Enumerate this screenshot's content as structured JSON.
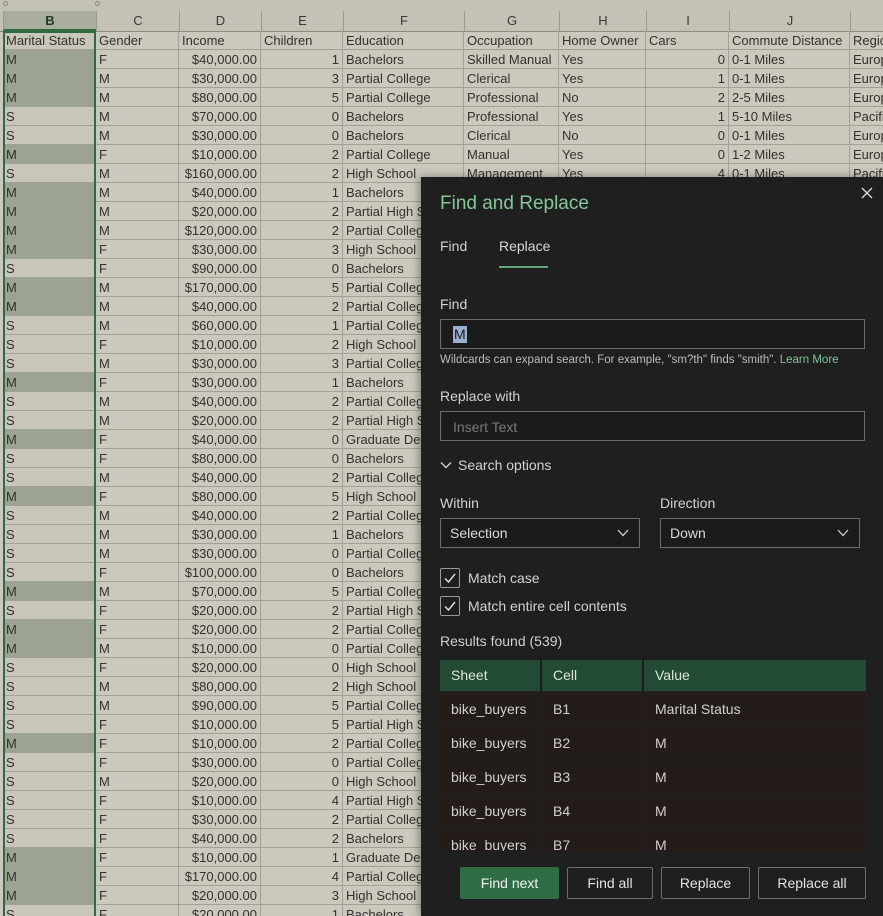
{
  "columns": [
    {
      "letter": "B",
      "header": "Marital Status"
    },
    {
      "letter": "C",
      "header": "Gender"
    },
    {
      "letter": "D",
      "header": "Income"
    },
    {
      "letter": "E",
      "header": "Children"
    },
    {
      "letter": "F",
      "header": "Education"
    },
    {
      "letter": "G",
      "header": "Occupation"
    },
    {
      "letter": "H",
      "header": "Home Owner"
    },
    {
      "letter": "I",
      "header": "Cars"
    },
    {
      "letter": "J",
      "header": "Commute Distance"
    },
    {
      "letter": "",
      "header": "Regic"
    }
  ],
  "rows": [
    [
      "M",
      "F",
      "$40,000.00",
      "1",
      "Bachelors",
      "Skilled Manual",
      "Yes",
      "0",
      "0-1 Miles",
      "Europ"
    ],
    [
      "M",
      "M",
      "$30,000.00",
      "3",
      "Partial College",
      "Clerical",
      "Yes",
      "1",
      "0-1 Miles",
      "Europ"
    ],
    [
      "M",
      "M",
      "$80,000.00",
      "5",
      "Partial College",
      "Professional",
      "No",
      "2",
      "2-5 Miles",
      "Europ"
    ],
    [
      "S",
      "M",
      "$70,000.00",
      "0",
      "Bachelors",
      "Professional",
      "Yes",
      "1",
      "5-10 Miles",
      "Pacifi"
    ],
    [
      "S",
      "M",
      "$30,000.00",
      "0",
      "Bachelors",
      "Clerical",
      "No",
      "0",
      "0-1 Miles",
      "Europ"
    ],
    [
      "M",
      "F",
      "$10,000.00",
      "2",
      "Partial College",
      "Manual",
      "Yes",
      "0",
      "1-2 Miles",
      "Europ"
    ],
    [
      "S",
      "M",
      "$160,000.00",
      "2",
      "High School",
      "Management",
      "Yes",
      "4",
      "0-1 Miles",
      "Pacifi"
    ],
    [
      "M",
      "M",
      "$40,000.00",
      "1",
      "Bachelors",
      "",
      "",
      "",
      "",
      ""
    ],
    [
      "M",
      "M",
      "$20,000.00",
      "2",
      "Partial High S",
      "",
      "",
      "",
      "",
      ""
    ],
    [
      "M",
      "M",
      "$120,000.00",
      "2",
      "Partial Colleg",
      "",
      "",
      "",
      "",
      ""
    ],
    [
      "M",
      "F",
      "$30,000.00",
      "3",
      "High School",
      "",
      "",
      "",
      "",
      ""
    ],
    [
      "S",
      "F",
      "$90,000.00",
      "0",
      "Bachelors",
      "",
      "",
      "",
      "",
      ""
    ],
    [
      "M",
      "M",
      "$170,000.00",
      "5",
      "Partial Colleg",
      "",
      "",
      "",
      "",
      ""
    ],
    [
      "M",
      "M",
      "$40,000.00",
      "2",
      "Partial Colleg",
      "",
      "",
      "",
      "",
      ""
    ],
    [
      "S",
      "M",
      "$60,000.00",
      "1",
      "Partial Colleg",
      "",
      "",
      "",
      "",
      ""
    ],
    [
      "S",
      "F",
      "$10,000.00",
      "2",
      "High School",
      "",
      "",
      "",
      "",
      ""
    ],
    [
      "S",
      "M",
      "$30,000.00",
      "3",
      "Partial Colleg",
      "",
      "",
      "",
      "",
      ""
    ],
    [
      "M",
      "F",
      "$30,000.00",
      "1",
      "Bachelors",
      "",
      "",
      "",
      "",
      ""
    ],
    [
      "S",
      "M",
      "$40,000.00",
      "2",
      "Partial Colleg",
      "",
      "",
      "",
      "",
      ""
    ],
    [
      "S",
      "M",
      "$20,000.00",
      "2",
      "Partial High S",
      "",
      "",
      "",
      "",
      ""
    ],
    [
      "M",
      "F",
      "$40,000.00",
      "0",
      "Graduate Deg",
      "",
      "",
      "",
      "",
      ""
    ],
    [
      "S",
      "F",
      "$80,000.00",
      "0",
      "Bachelors",
      "",
      "",
      "",
      "",
      ""
    ],
    [
      "S",
      "M",
      "$40,000.00",
      "2",
      "Partial Colleg",
      "",
      "",
      "",
      "",
      ""
    ],
    [
      "M",
      "F",
      "$80,000.00",
      "5",
      "High School",
      "",
      "",
      "",
      "",
      ""
    ],
    [
      "S",
      "M",
      "$40,000.00",
      "2",
      "Partial Colleg",
      "",
      "",
      "",
      "",
      ""
    ],
    [
      "S",
      "M",
      "$30,000.00",
      "1",
      "Bachelors",
      "",
      "",
      "",
      "",
      ""
    ],
    [
      "S",
      "M",
      "$30,000.00",
      "0",
      "Partial Colleg",
      "",
      "",
      "",
      "",
      ""
    ],
    [
      "S",
      "F",
      "$100,000.00",
      "0",
      "Bachelors",
      "",
      "",
      "",
      "",
      ""
    ],
    [
      "M",
      "M",
      "$70,000.00",
      "5",
      "Partial Colleg",
      "",
      "",
      "",
      "",
      ""
    ],
    [
      "S",
      "F",
      "$20,000.00",
      "2",
      "Partial High S",
      "",
      "",
      "",
      "",
      ""
    ],
    [
      "M",
      "F",
      "$20,000.00",
      "2",
      "Partial Colleg",
      "",
      "",
      "",
      "",
      ""
    ],
    [
      "M",
      "M",
      "$10,000.00",
      "0",
      "Partial Colleg",
      "",
      "",
      "",
      "",
      ""
    ],
    [
      "S",
      "F",
      "$20,000.00",
      "0",
      "High School",
      "",
      "",
      "",
      "",
      ""
    ],
    [
      "S",
      "M",
      "$80,000.00",
      "2",
      "High School",
      "",
      "",
      "",
      "",
      ""
    ],
    [
      "S",
      "M",
      "$90,000.00",
      "5",
      "Partial Colleg",
      "",
      "",
      "",
      "",
      ""
    ],
    [
      "S",
      "F",
      "$10,000.00",
      "5",
      "Partial High S",
      "",
      "",
      "",
      "",
      ""
    ],
    [
      "M",
      "F",
      "$10,000.00",
      "2",
      "Partial Colleg",
      "",
      "",
      "",
      "",
      ""
    ],
    [
      "S",
      "F",
      "$30,000.00",
      "0",
      "Partial Colleg",
      "",
      "",
      "",
      "",
      ""
    ],
    [
      "S",
      "M",
      "$20,000.00",
      "0",
      "High School",
      "",
      "",
      "",
      "",
      ""
    ],
    [
      "S",
      "F",
      "$10,000.00",
      "4",
      "Partial High S",
      "",
      "",
      "",
      "",
      ""
    ],
    [
      "S",
      "F",
      "$30,000.00",
      "2",
      "Partial Colleg",
      "",
      "",
      "",
      "",
      ""
    ],
    [
      "S",
      "F",
      "$40,000.00",
      "2",
      "Bachelors",
      "",
      "",
      "",
      "",
      ""
    ],
    [
      "M",
      "F",
      "$10,000.00",
      "1",
      "Graduate Deg",
      "",
      "",
      "",
      "",
      ""
    ],
    [
      "M",
      "F",
      "$170,000.00",
      "4",
      "Partial Colleg",
      "",
      "",
      "",
      "",
      ""
    ],
    [
      "M",
      "F",
      "$20,000.00",
      "3",
      "High School",
      "",
      "",
      "",
      "",
      ""
    ],
    [
      "S",
      "F",
      "$20,000.00",
      "1",
      "Bachelors",
      "",
      "",
      "",
      "",
      ""
    ]
  ],
  "dialog": {
    "title": "Find and Replace",
    "tabs": {
      "find": "Find",
      "replace": "Replace"
    },
    "find_label": "Find",
    "find_value": "M",
    "hint": "Wildcards can expand search. For example, \"sm?th\" finds \"smith\".",
    "learn_more": "Learn More",
    "replace_label": "Replace with",
    "replace_placeholder": "Insert Text",
    "search_options": "Search options",
    "within_label": "Within",
    "within_value": "Selection",
    "direction_label": "Direction",
    "direction_value": "Down",
    "match_case": "Match case",
    "match_entire": "Match entire cell contents",
    "results_label": "Results found (539)",
    "table_headers": {
      "sheet": "Sheet",
      "cell": "Cell",
      "value": "Value"
    },
    "results": [
      {
        "sheet": "bike_buyers",
        "cell": "B1",
        "value": "Marital Status"
      },
      {
        "sheet": "bike_buyers",
        "cell": "B2",
        "value": "M"
      },
      {
        "sheet": "bike_buyers",
        "cell": "B3",
        "value": "M"
      },
      {
        "sheet": "bike_buyers",
        "cell": "B4",
        "value": "M"
      },
      {
        "sheet": "bike_buyers",
        "cell": "B7",
        "value": "M"
      }
    ],
    "buttons": {
      "find_next": "Find next",
      "find_all": "Find all",
      "replace": "Replace",
      "replace_all": "Replace all"
    }
  },
  "colors": {
    "accent": "#2f6e44",
    "selection": "#2e6b3e",
    "title": "#86c79a"
  }
}
